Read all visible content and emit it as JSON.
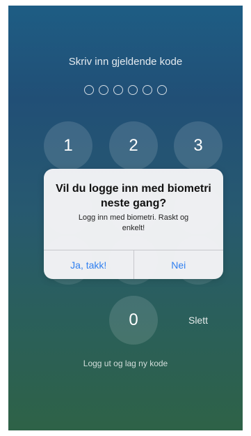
{
  "passcode": {
    "prompt": "Skriv inn gjeldende kode",
    "digit_slots": 6,
    "entered": 0
  },
  "keypad": {
    "keys": [
      "1",
      "2",
      "3",
      "",
      "",
      "",
      "",
      "",
      "",
      "",
      "0"
    ],
    "delete_label": "Slett"
  },
  "logout_link": "Logg ut og lag ny kode",
  "alert": {
    "title": "Vil du logge inn med biometri neste gang?",
    "message": "Logg inn med biometri. Raskt og enkelt!",
    "yes_label": "Ja, takk!",
    "no_label": "Nei",
    "button_color": "#2f7ff0"
  }
}
